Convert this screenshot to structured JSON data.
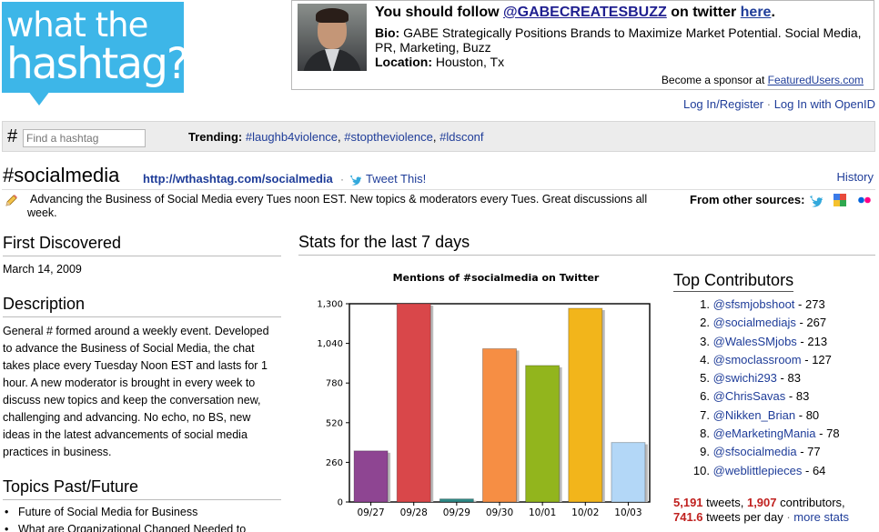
{
  "logo": {
    "line1": "what the",
    "line2": "hashtag?!"
  },
  "sponsor": {
    "follow_prefix": "You should follow ",
    "handle": "@GABECREATESBUZZ",
    "follow_mid": " on twitter ",
    "here": "here",
    "follow_end": ".",
    "bio_label": "Bio:",
    "bio": "GABE Strategically Positions Brands to Maximize Market Potential. Social Media, PR, Marketing, Buzz",
    "location_label": "Location:",
    "location": "Houston, Tx",
    "footer_text": "Become a sponsor at ",
    "footer_link": "FeaturedUsers.com"
  },
  "auth": {
    "login": "Log In/Register",
    "sep": " · ",
    "openid": "Log In with OpenID"
  },
  "search": {
    "hash": "#",
    "placeholder": "Find a hashtag"
  },
  "trending": {
    "label": "Trending:",
    "items": [
      "#laughb4violence",
      "#stoptheviolence",
      "#ldsconf"
    ]
  },
  "hashtag": {
    "title": "#socialmedia",
    "url": "http://wthashtag.com/socialmedia",
    "sep": "·",
    "tweet_this": "Tweet This!",
    "history": "History",
    "description": "Advancing the Business of Social Media every Tues noon EST. New topics & moderators every Tues. Great discussions all week.",
    "sources_label": "From other sources:"
  },
  "first_discovered": {
    "heading": "First Discovered",
    "date": "March 14, 2009"
  },
  "description_section": {
    "heading": "Description",
    "text": "General # formed around a weekly event. Developed to advance the Business of Social Media, the chat takes place every Tuesday Noon EST and lasts for 1 hour. A new moderator is brought in every week to discuss new topics and keep the conversation new, challenging and advancing. No echo, no BS, new ideas in the latest advancements of social media practices in business."
  },
  "topics": {
    "heading": "Topics Past/Future",
    "items": [
      "Future of Social Media for Business",
      "What are Organizational Changed Needed to"
    ]
  },
  "stats": {
    "heading": "Stats for the last 7 days"
  },
  "chart_data": {
    "type": "bar",
    "title": "Mentions of #socialmedia on Twitter",
    "categories": [
      "09/27",
      "09/28",
      "09/29",
      "09/30",
      "10/01",
      "10/02",
      "10/03"
    ],
    "values": [
      335,
      1300,
      20,
      1005,
      895,
      1270,
      390
    ],
    "colors": [
      "#8e4592",
      "#d9474a",
      "#2e8a87",
      "#f68e44",
      "#92b51d",
      "#f2b51b",
      "#b3d7f7"
    ],
    "ylim": [
      0,
      1300
    ],
    "yticks": [
      0,
      260,
      520,
      780,
      "1,040",
      "1,300"
    ],
    "ytick_values": [
      0,
      260,
      520,
      780,
      1040,
      1300
    ],
    "grid": false
  },
  "contributors": {
    "heading": "Top Contributors",
    "items": [
      {
        "handle": "@sfsmjobshoot",
        "count": "273"
      },
      {
        "handle": "@socialmediajs",
        "count": "267"
      },
      {
        "handle": "@WalesSMjobs",
        "count": "213"
      },
      {
        "handle": "@smoclassroom",
        "count": "127"
      },
      {
        "handle": "@swichi293",
        "count": "83"
      },
      {
        "handle": "@ChrisSavas",
        "count": "83"
      },
      {
        "handle": "@Nikken_Brian",
        "count": "80"
      },
      {
        "handle": "@eMarketingMania",
        "count": "78"
      },
      {
        "handle": "@sfsocialmedia",
        "count": "77"
      },
      {
        "handle": "@weblittlepieces",
        "count": "64"
      }
    ]
  },
  "summary": {
    "tweets": "5,191",
    "tweets_label": " tweets, ",
    "contributors": "1,907",
    "contributors_label": " contributors,",
    "per_day": "741.6",
    "per_day_label": " tweets per day",
    "sep": " · ",
    "more": "more stats"
  }
}
